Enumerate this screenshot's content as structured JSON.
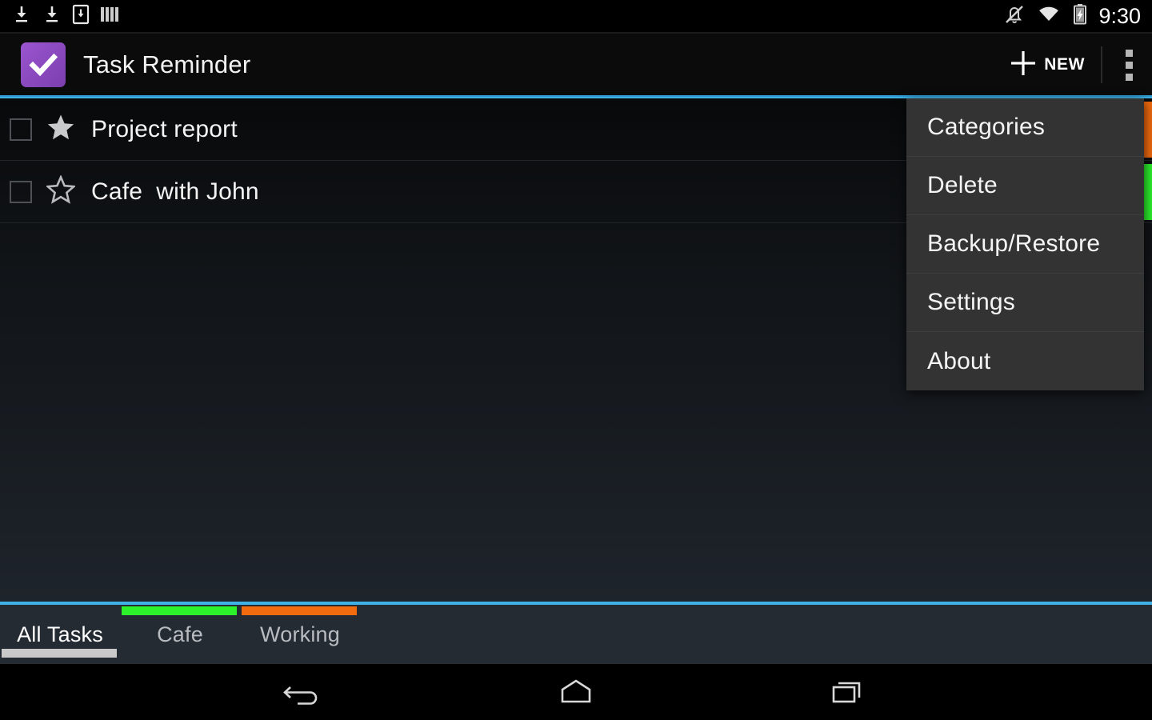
{
  "statusbar": {
    "left_icons": [
      {
        "name": "download-icon",
        "glyph": "download"
      },
      {
        "name": "download-icon-2",
        "glyph": "download"
      },
      {
        "name": "save-to-device-icon",
        "glyph": "download-box"
      },
      {
        "name": "library-bars-icon",
        "glyph": "bars"
      }
    ],
    "right_icons": [
      {
        "name": "silent-mode-icon",
        "glyph": "bell-muted"
      },
      {
        "name": "wifi-icon",
        "glyph": "wifi"
      },
      {
        "name": "battery-charging-icon",
        "glyph": "battery-charging"
      }
    ],
    "clock": "9:30"
  },
  "actionbar": {
    "app_icon_name": "app-logo-checkmark",
    "title": "Task Reminder",
    "new_label": "NEW",
    "plus_icon_name": "plus-icon",
    "overflow_icon_name": "overflow-menu-icon",
    "accent_color": "#3fb3e8",
    "logo_color": "#8a4bbf"
  },
  "tasks": [
    {
      "title": "Project report",
      "checked": false,
      "starred": true,
      "category_color": "#f26b0f"
    },
    {
      "title": "Cafe  with John",
      "checked": false,
      "starred": false,
      "category_color": "#2cf22c"
    }
  ],
  "dropdown": {
    "visible": true,
    "items": [
      {
        "label": "Categories"
      },
      {
        "label": "Delete"
      },
      {
        "label": "Backup/Restore"
      },
      {
        "label": "Settings"
      },
      {
        "label": "About"
      }
    ]
  },
  "tabbar": {
    "tabs": [
      {
        "label": "All Tasks",
        "active": true,
        "color": null,
        "text_color": "#ffffff"
      },
      {
        "label": "Cafe",
        "active": false,
        "color": "#2cf22c",
        "text_color": "#b8bcc0"
      },
      {
        "label": "Working",
        "active": false,
        "color": "#f26b0f",
        "text_color": "#b8bcc0"
      }
    ],
    "active_indicator_color": "#c9c9c9",
    "top_line_color": "#3fb3e8"
  },
  "navbar": {
    "buttons": [
      {
        "name": "back-button",
        "glyph": "back"
      },
      {
        "name": "home-button",
        "glyph": "home"
      },
      {
        "name": "recent-apps-button",
        "glyph": "recents"
      }
    ]
  }
}
